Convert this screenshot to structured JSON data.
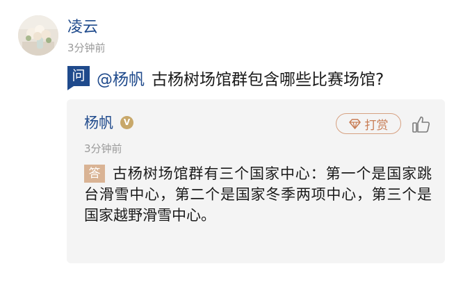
{
  "question": {
    "asker_name": "凌云",
    "asker_time": "3分钟前",
    "badge": "问",
    "mention": "@杨帆",
    "text": "古杨树场馆群包含哪些比赛场馆?"
  },
  "answer": {
    "answerer_name": "杨帆",
    "verified_badge": "V",
    "reward_label": "打赏",
    "time": "3分钟前",
    "badge": "答",
    "text": "古杨树场馆群有三个国家中心：第一个是国家跳台滑雪中心，第二个是国家冬季两项中心，第三个是国家越野滑雪中心。"
  },
  "icons": {
    "avatar": "flower-avatar",
    "reward": "gem-icon",
    "like": "thumbs-up-icon"
  },
  "colors": {
    "brand_blue": "#1f4a8c",
    "answer_badge": "#d9b394",
    "reward_accent": "#c87d55",
    "card_background": "#f4f4f4",
    "muted_text": "#9a9a9a"
  }
}
